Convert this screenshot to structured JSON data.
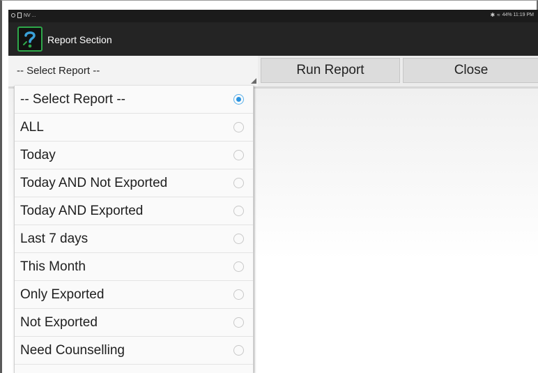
{
  "status_bar": {
    "left_icons": [
      "circle-icon",
      "sim-icon"
    ],
    "left_text": "NV ...",
    "right_text": "44% 11:19 PM",
    "right_icons": [
      "bluetooth-icon",
      "wifi-icon",
      "battery-icon"
    ]
  },
  "app_bar": {
    "title": "Report Section",
    "logo_icon": "question-mark-logo-icon",
    "logo_color": "#2ea84a"
  },
  "toolbar": {
    "select_value": "-- Select Report --",
    "run_label": "Run Report",
    "close_label": "Close"
  },
  "dropdown": {
    "selected_index": 0,
    "radio_accent": "#2a93e0",
    "options": [
      {
        "label": "-- Select Report --",
        "checked": true
      },
      {
        "label": "ALL",
        "checked": false
      },
      {
        "label": "Today",
        "checked": false
      },
      {
        "label": "Today AND Not Exported",
        "checked": false
      },
      {
        "label": "Today AND Exported",
        "checked": false
      },
      {
        "label": "Last 7 days",
        "checked": false
      },
      {
        "label": "This Month",
        "checked": false
      },
      {
        "label": "Only Exported",
        "checked": false
      },
      {
        "label": "Not Exported",
        "checked": false
      },
      {
        "label": "Need Counselling",
        "checked": false
      }
    ]
  }
}
